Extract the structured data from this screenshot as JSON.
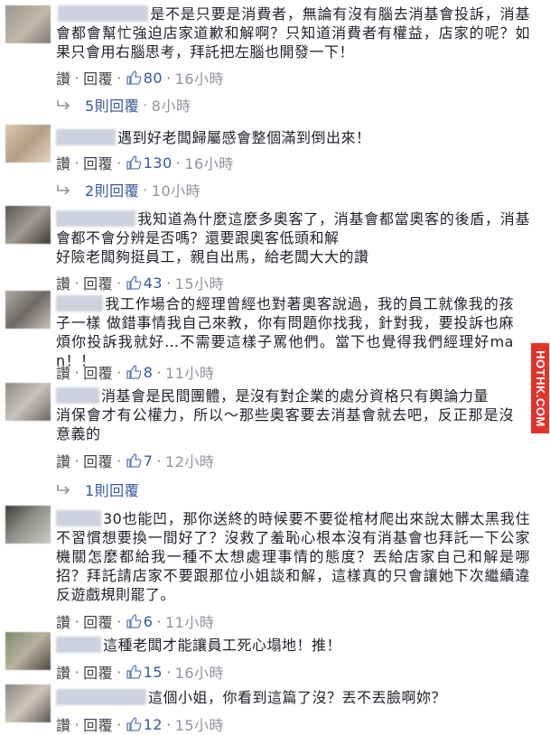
{
  "actions": {
    "reply_label": "回覆",
    "like_label": "讚",
    "dot": "·"
  },
  "comments": [
    {
      "text": "是不是只要是消費者，無論有沒有腦去消基會投訴，消基會都會幫忙強迫店家道歉和解啊？只知道消費者有權益，店家的呢？如果只會用右腦思考，拜託把左腦也開發一下！",
      "likes": "80",
      "time": "16小時",
      "replies": "5則回覆",
      "reply_time": "8小時"
    },
    {
      "text": "遇到好老闆歸屬感會整個滿到倒出來！",
      "likes": "130",
      "time": "16小時",
      "replies": "2則回覆",
      "reply_time": "10小時"
    },
    {
      "text": "我知道為什麼這麼多奧客了，消基會都當奧客的後盾，消基會都不會分辨是否嗎？還要跟奧客低頭和解",
      "text2": "好險老闆夠挺員工，親自出馬，給老闆大大的讚",
      "likes": "43",
      "time": "15小時"
    },
    {
      "text": "我工作場合的經理曾經也對著奧客說過，我的員工就像我的孩子一樣 做錯事情我自己來教，你有問題你找我，針對我，要投訴也麻煩你投訴我就好…不需要這樣子罵他們。當下也覺得我們經理好man！！",
      "likes": "8",
      "time": "11小時"
    },
    {
      "text": "消基會是民間團體，是沒有對企業的處分資格只有輿論力量",
      "text2": "消保會才有公權力，所以～那些奧客要去消基會就去吧，反正那是沒意義的",
      "likes": "7",
      "time": "12小時",
      "replies": "1則回覆"
    },
    {
      "text": "30也能凹，那你送終的時候要不要從棺材爬出來說太髒太黑我住不習慣想要換一間好了？沒救了羞恥心根本沒有消基會也拜託一下公家機關怎麼都給我一種不太想處理事情的態度？丟給店家自己和解是哪招？拜託請店家不要跟那位小姐談和解，這樣真的只會讓她下次繼續違反遊戲規則罷了。",
      "likes": "6",
      "time": "11小時"
    },
    {
      "text": "這種老闆才能讓員工死心塌地！推！",
      "likes": "15",
      "time": "16小時"
    },
    {
      "text": "這個小姐，你看到這篇了沒？丟不丟臉啊妳？",
      "likes": "12",
      "time": "15小時"
    }
  ],
  "watermark": "HOTHK.COM"
}
